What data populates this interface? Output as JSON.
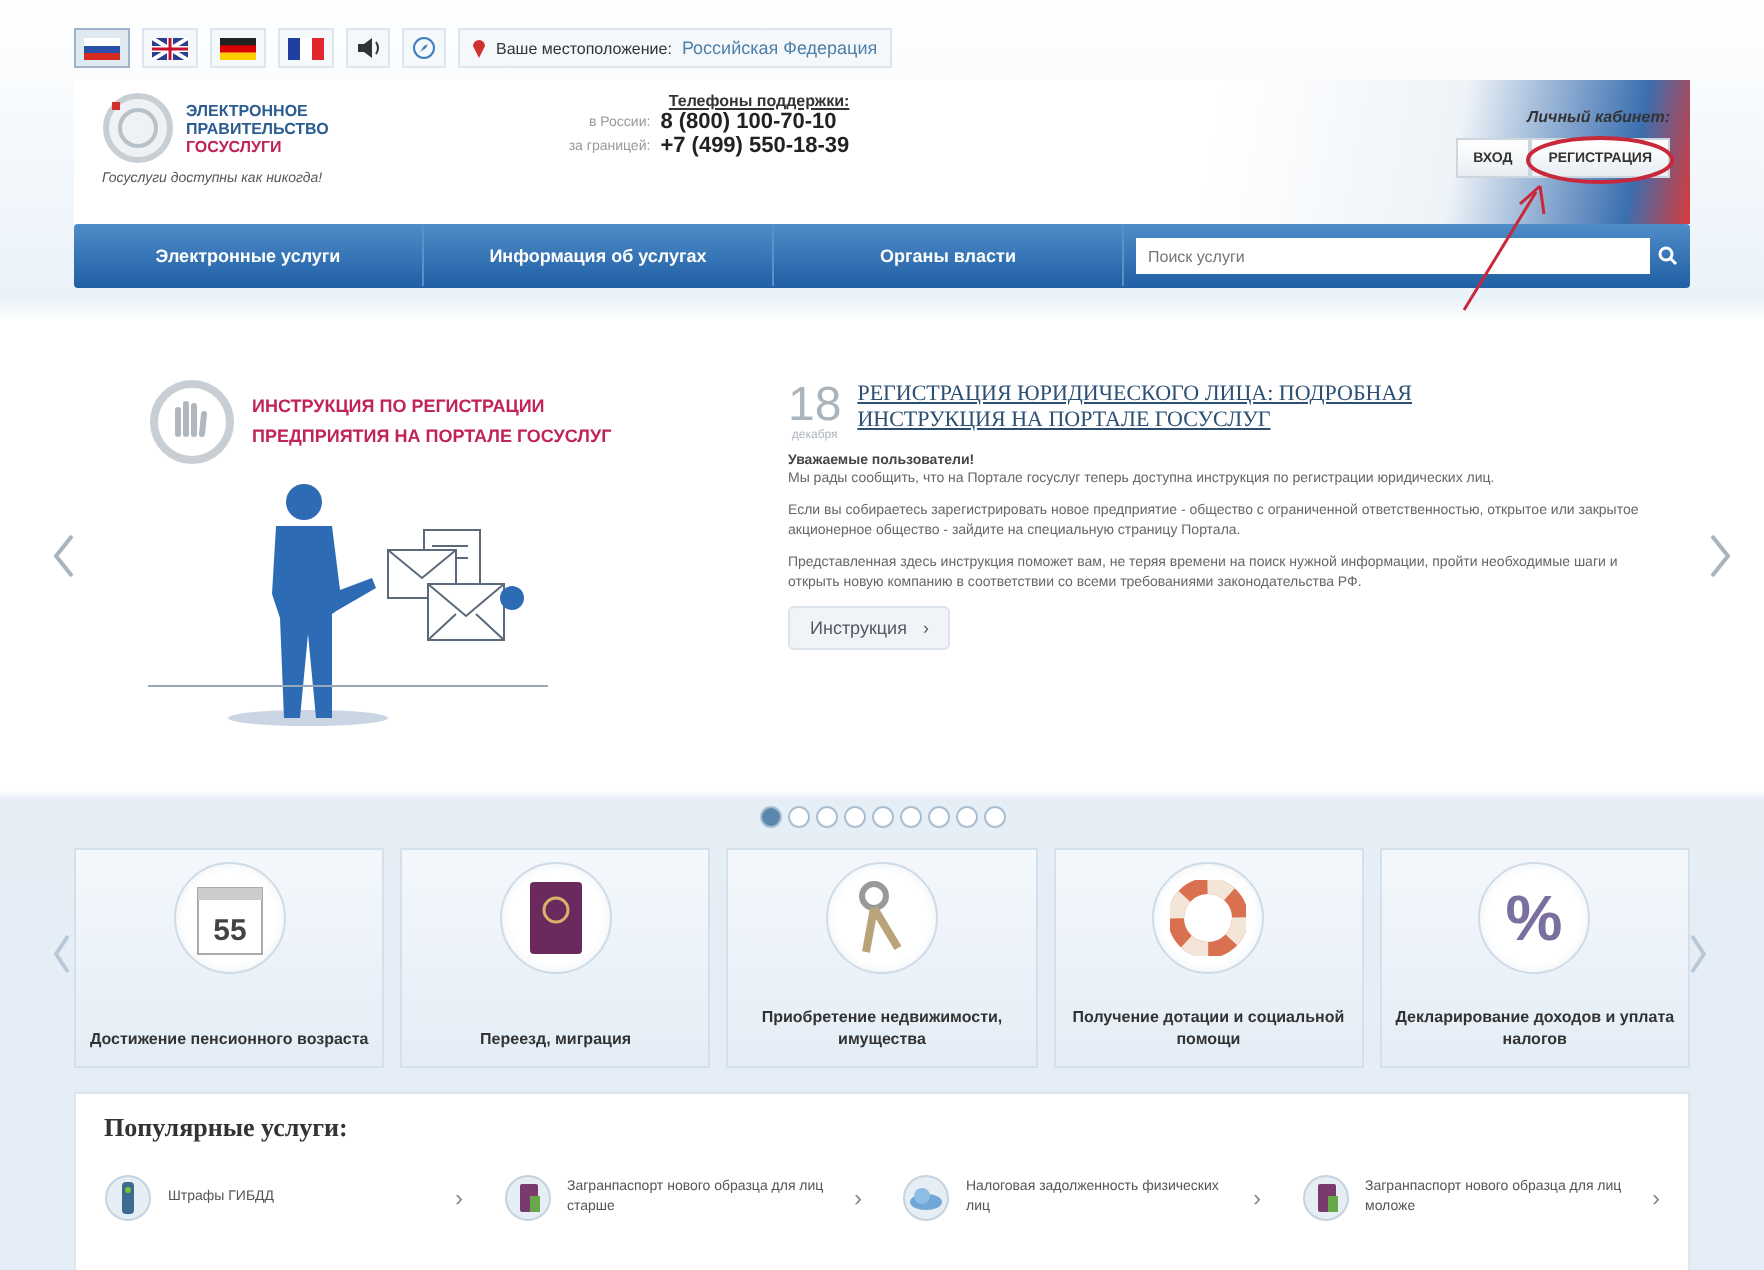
{
  "top_bar": {
    "languages": [
      {
        "kind": "ru",
        "selected": true
      },
      {
        "kind": "gb",
        "selected": false
      },
      {
        "kind": "de",
        "selected": false
      },
      {
        "kind": "fr",
        "selected": false
      }
    ],
    "location_label": "Ваше местоположение:",
    "location_value": "Российская Федерация"
  },
  "header": {
    "logo_line1": "ЭЛЕКТРОННОЕ",
    "logo_line2": "ПРАВИТЕЛЬСТВО",
    "logo_line3": "ГОСУСЛУГИ",
    "tagline": "Госуслуги доступны как никогда!",
    "phones_title": "Телефоны поддержки:",
    "phones": [
      {
        "label": "в России:",
        "number": "8 (800) 100-70-10"
      },
      {
        "label": "за границей:",
        "number": "+7 (499) 550-18-39"
      }
    ],
    "cabinet_title": "Личный кабинет:",
    "login": "ВХОД",
    "register": "РЕГИСТРАЦИЯ"
  },
  "nav": {
    "items": [
      "Электронные услуги",
      "Информация об услугах",
      "Органы власти"
    ],
    "search_placeholder": "Поиск услуги"
  },
  "slide": {
    "banner": "ИНСТРУКЦИЯ ПО РЕГИСТРАЦИИ ПРЕДПРИЯТИЯ НА ПОРТАЛЕ ГОСУСЛУГ",
    "day": "18",
    "month": "декабря",
    "title": "РЕГИСТРАЦИЯ ЮРИДИЧЕСКОГО ЛИЦА: ПОДРОБНАЯ ИНСТРУКЦИЯ НА ПОРТАЛЕ ГОСУСЛУГ",
    "greeting": "Уважаемые пользователи!",
    "paragraphs": [
      "Мы рады сообщить, что на Портале госуслуг теперь доступна инструкция по регистрации юридических лиц.",
      "Если вы собираетесь зарегистрировать новое предприятие - общество с ограниченной ответственностью, открытое или закрытое акционерное общество - зайдите на специальную страницу Портала.",
      "Представленная здесь инструкция поможет вам, не теряя времени на поиск нужной информации, пройти необходимые шаги и открыть новую компанию в соответствии со всеми требованиями законодательства РФ."
    ],
    "button": "Инструкция",
    "button_chevron": "›"
  },
  "slider_dots": [
    {
      "selected": true
    },
    {
      "selected": false
    },
    {
      "selected": false
    },
    {
      "selected": false
    },
    {
      "selected": false
    },
    {
      "selected": false
    },
    {
      "selected": false
    },
    {
      "selected": false
    },
    {
      "selected": false
    }
  ],
  "categories": [
    {
      "kind": "calendar",
      "icon_text": "55",
      "label": "Достижение пенсионного возраста"
    },
    {
      "kind": "passport",
      "label": "Переезд, миграция"
    },
    {
      "kind": "keys",
      "label": "Приобретение недвижимости, имущества"
    },
    {
      "kind": "lifebuoy",
      "label": "Получение дотации и социальной помощи"
    },
    {
      "kind": "percent",
      "icon_text": "%",
      "label": "Декларирование доходов и уплата налогов"
    }
  ],
  "popular": {
    "title": "Популярные услуги:",
    "items": [
      {
        "kind": "traffic",
        "label": "Штрафы ГИБДД",
        "chevron": "›"
      },
      {
        "kind": "passport",
        "label": "Загранпаспорт нового образца для лиц старше",
        "chevron": "›"
      },
      {
        "kind": "tax",
        "label": "Налоговая задолженность физических лиц",
        "chevron": "›"
      },
      {
        "kind": "passport",
        "label": "Загранпаспорт нового образца для лиц моложе",
        "chevron": "›"
      }
    ]
  }
}
